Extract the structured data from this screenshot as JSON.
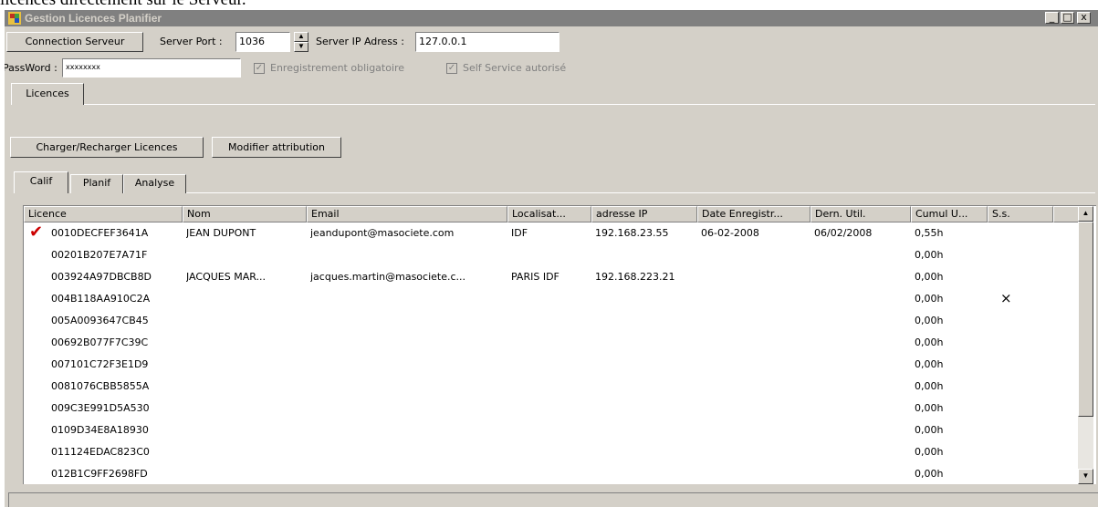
{
  "doc_text": "licences directement sur le Serveur.",
  "window": {
    "title": "Gestion Licences Planifier",
    "minimize": "_",
    "maximize": "□",
    "close": "x"
  },
  "connection": {
    "connect_button": "Connection Serveur",
    "port_label": "Server Port :",
    "port_value": "1036",
    "ip_label": "Server IP Adress :",
    "ip_value": "127.0.0.1",
    "password_label": "PassWord :",
    "password_value": "xxxxxxxx",
    "chk_registration": "Enregistrement obligatoire",
    "chk_selfservice": "Self Service autorisé"
  },
  "main_tabs": [
    "Licences"
  ],
  "actions": {
    "load_button": "Charger/Recharger Licences",
    "modify_button": "Modifier attribution"
  },
  "sub_tabs": [
    "Calif",
    "Planif",
    "Analyse"
  ],
  "table": {
    "columns": [
      "Licence",
      "Nom",
      "Email",
      "Localisat...",
      "adresse IP",
      "Date Enregistr...",
      "Dern. Util.",
      "Cumul U...",
      "S.s."
    ],
    "rows": [
      {
        "checked": true,
        "licence": "0010DECFEF3641A",
        "nom": "JEAN DUPONT",
        "email": "jeandupont@masociete.com",
        "loc": "IDF",
        "ip": "192.168.23.55",
        "date": "06-02-2008",
        "dern": "06/02/2008",
        "cumul": "0,55h",
        "ss": ""
      },
      {
        "checked": false,
        "licence": "00201B207E7A71F",
        "nom": "",
        "email": "",
        "loc": "",
        "ip": "",
        "date": "",
        "dern": "",
        "cumul": "0,00h",
        "ss": ""
      },
      {
        "checked": false,
        "licence": "003924A97DBCB8D",
        "nom": "JACQUES MAR...",
        "email": "jacques.martin@masociete.c...",
        "loc": "PARIS IDF",
        "ip": "192.168.223.21",
        "date": "",
        "dern": "",
        "cumul": "0,00h",
        "ss": ""
      },
      {
        "checked": false,
        "licence": "004B118AA910C2A",
        "nom": "",
        "email": "",
        "loc": "",
        "ip": "",
        "date": "",
        "dern": "",
        "cumul": "0,00h",
        "ss": "×"
      },
      {
        "checked": false,
        "licence": "005A0093647CB45",
        "nom": "",
        "email": "",
        "loc": "",
        "ip": "",
        "date": "",
        "dern": "",
        "cumul": "0,00h",
        "ss": ""
      },
      {
        "checked": false,
        "licence": "00692B077F7C39C",
        "nom": "",
        "email": "",
        "loc": "",
        "ip": "",
        "date": "",
        "dern": "",
        "cumul": "0,00h",
        "ss": ""
      },
      {
        "checked": false,
        "licence": "007101C72F3E1D9",
        "nom": "",
        "email": "",
        "loc": "",
        "ip": "",
        "date": "",
        "dern": "",
        "cumul": "0,00h",
        "ss": ""
      },
      {
        "checked": false,
        "licence": "0081076CBB5855A",
        "nom": "",
        "email": "",
        "loc": "",
        "ip": "",
        "date": "",
        "dern": "",
        "cumul": "0,00h",
        "ss": ""
      },
      {
        "checked": false,
        "licence": "009C3E991D5A530",
        "nom": "",
        "email": "",
        "loc": "",
        "ip": "",
        "date": "",
        "dern": "",
        "cumul": "0,00h",
        "ss": ""
      },
      {
        "checked": false,
        "licence": "0109D34E8A18930",
        "nom": "",
        "email": "",
        "loc": "",
        "ip": "",
        "date": "",
        "dern": "",
        "cumul": "0,00h",
        "ss": ""
      },
      {
        "checked": false,
        "licence": "011124EDAC823C0",
        "nom": "",
        "email": "",
        "loc": "",
        "ip": "",
        "date": "",
        "dern": "",
        "cumul": "0,00h",
        "ss": ""
      },
      {
        "checked": false,
        "licence": "012B1C9FF2698FD",
        "nom": "",
        "email": "",
        "loc": "",
        "ip": "",
        "date": "",
        "dern": "",
        "cumul": "0,00h",
        "ss": ""
      }
    ]
  },
  "colors": {
    "check_mark": "#cc0000",
    "title_bar": "#808080",
    "face": "#d4d0c8"
  }
}
